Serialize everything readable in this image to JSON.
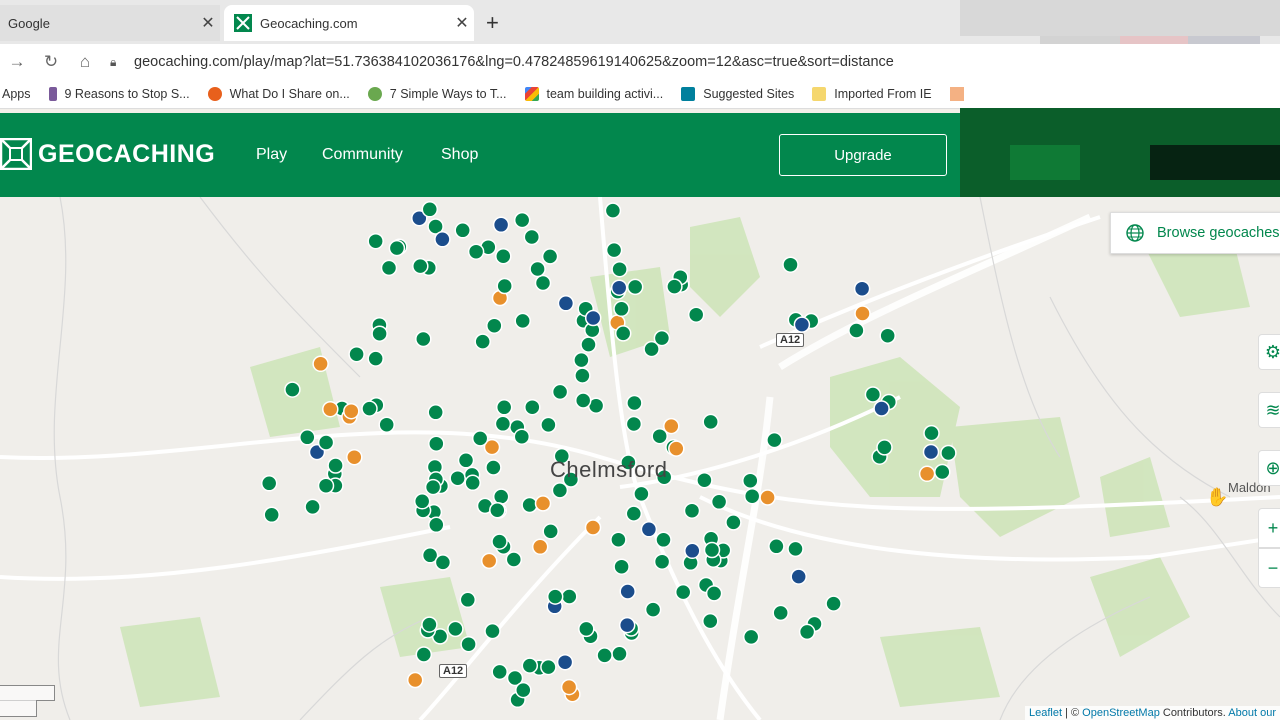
{
  "browser": {
    "tabs": [
      {
        "title": "Google",
        "active": false
      },
      {
        "title": "Geocaching.com",
        "active": true
      }
    ],
    "url": "geocaching.com/play/map?lat=51.736384102036176&lng=0.47824859619140625&zoom=12&asc=true&sort=distance",
    "bookmarks": [
      {
        "label": "Apps",
        "icon": "apps-icon"
      },
      {
        "label": "9 Reasons to Stop S...",
        "icon": "bookmark-icon"
      },
      {
        "label": "What Do I Share on...",
        "icon": "bookmark-icon"
      },
      {
        "label": "7 Simple Ways to T...",
        "icon": "bookmark-icon"
      },
      {
        "label": "team building activi...",
        "icon": "google-icon"
      },
      {
        "label": "Suggested Sites",
        "icon": "bing-icon"
      },
      {
        "label": "Imported From IE",
        "icon": "folder-icon"
      }
    ]
  },
  "site": {
    "logo": "GEOCACHING",
    "nav": [
      "Play",
      "Community",
      "Shop"
    ],
    "upgrade": "Upgrade",
    "brand_color": "#02874d"
  },
  "map": {
    "browse_label": "Browse geocaches",
    "city_label": "Chelmsford",
    "town_label": "Maldon",
    "road_labels": [
      "A12",
      "A12"
    ],
    "attribution": {
      "leaflet": "Leaflet",
      "sep": " | © ",
      "osm": "OpenStreetMap",
      "contrib": " Contributors.",
      "about": "About our"
    },
    "zoom_in": "+",
    "zoom_out": "−"
  }
}
